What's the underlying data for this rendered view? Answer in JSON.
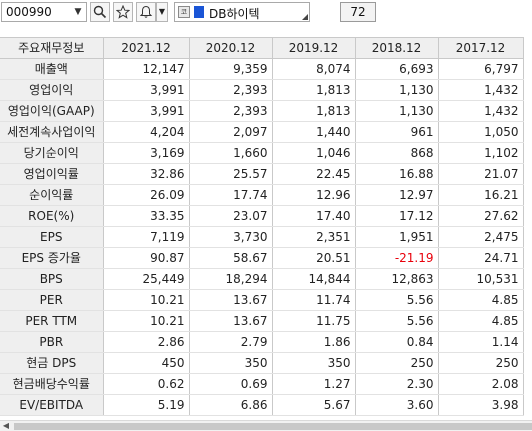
{
  "toolbar": {
    "stock_code": "000990",
    "code_dropdown_icon": "triangle-down",
    "search_icon": "magnifier",
    "star_icon": "star",
    "bell_icon": "bell",
    "bell_dropdown_icon": "triangle-down",
    "market_marker": "코",
    "company_name": "DB하이텍",
    "brand_color": "#1a55d6",
    "count": "72"
  },
  "table": {
    "columns": [
      "주요재무정보",
      "2021.12",
      "2020.12",
      "2019.12",
      "2018.12",
      "2017.12"
    ],
    "rows": [
      {
        "label": "매출액",
        "values": [
          "12,147",
          "9,359",
          "8,074",
          "6,693",
          "6,797"
        ]
      },
      {
        "label": "영업이익",
        "values": [
          "3,991",
          "2,393",
          "1,813",
          "1,130",
          "1,432"
        ]
      },
      {
        "label": "영업이익(GAAP)",
        "values": [
          "3,991",
          "2,393",
          "1,813",
          "1,130",
          "1,432"
        ]
      },
      {
        "label": "세전계속사업이익",
        "values": [
          "4,204",
          "2,097",
          "1,440",
          "961",
          "1,050"
        ]
      },
      {
        "label": "당기순이익",
        "values": [
          "3,169",
          "1,660",
          "1,046",
          "868",
          "1,102"
        ]
      },
      {
        "label": "영업이익률",
        "values": [
          "32.86",
          "25.57",
          "22.45",
          "16.88",
          "21.07"
        ]
      },
      {
        "label": "순이익률",
        "values": [
          "26.09",
          "17.74",
          "12.96",
          "12.97",
          "16.21"
        ]
      },
      {
        "label": "ROE(%)",
        "values": [
          "33.35",
          "23.07",
          "17.40",
          "17.12",
          "27.62"
        ]
      },
      {
        "label": "EPS",
        "values": [
          "7,119",
          "3,730",
          "2,351",
          "1,951",
          "2,475"
        ]
      },
      {
        "label": "EPS 증가율",
        "values": [
          "90.87",
          "58.67",
          "20.51",
          "-21.19",
          "24.71"
        ]
      },
      {
        "label": "BPS",
        "values": [
          "25,449",
          "18,294",
          "14,844",
          "12,863",
          "10,531"
        ]
      },
      {
        "label": "PER",
        "values": [
          "10.21",
          "13.67",
          "11.74",
          "5.56",
          "4.85"
        ]
      },
      {
        "label": "PER TTM",
        "values": [
          "10.21",
          "13.67",
          "11.75",
          "5.56",
          "4.85"
        ]
      },
      {
        "label": "PBR",
        "values": [
          "2.86",
          "2.79",
          "1.86",
          "0.84",
          "1.14"
        ]
      },
      {
        "label": "현금 DPS",
        "values": [
          "450",
          "350",
          "350",
          "250",
          "250"
        ]
      },
      {
        "label": "현금배당수익률",
        "values": [
          "0.62",
          "0.69",
          "1.27",
          "2.30",
          "2.08"
        ]
      },
      {
        "label": "EV/EBITDA",
        "values": [
          "5.19",
          "6.86",
          "5.67",
          "3.60",
          "3.98"
        ]
      }
    ],
    "negative_color": "#e8000b"
  },
  "scrollbar": {
    "left_arrow_icon": "triangle-left"
  }
}
